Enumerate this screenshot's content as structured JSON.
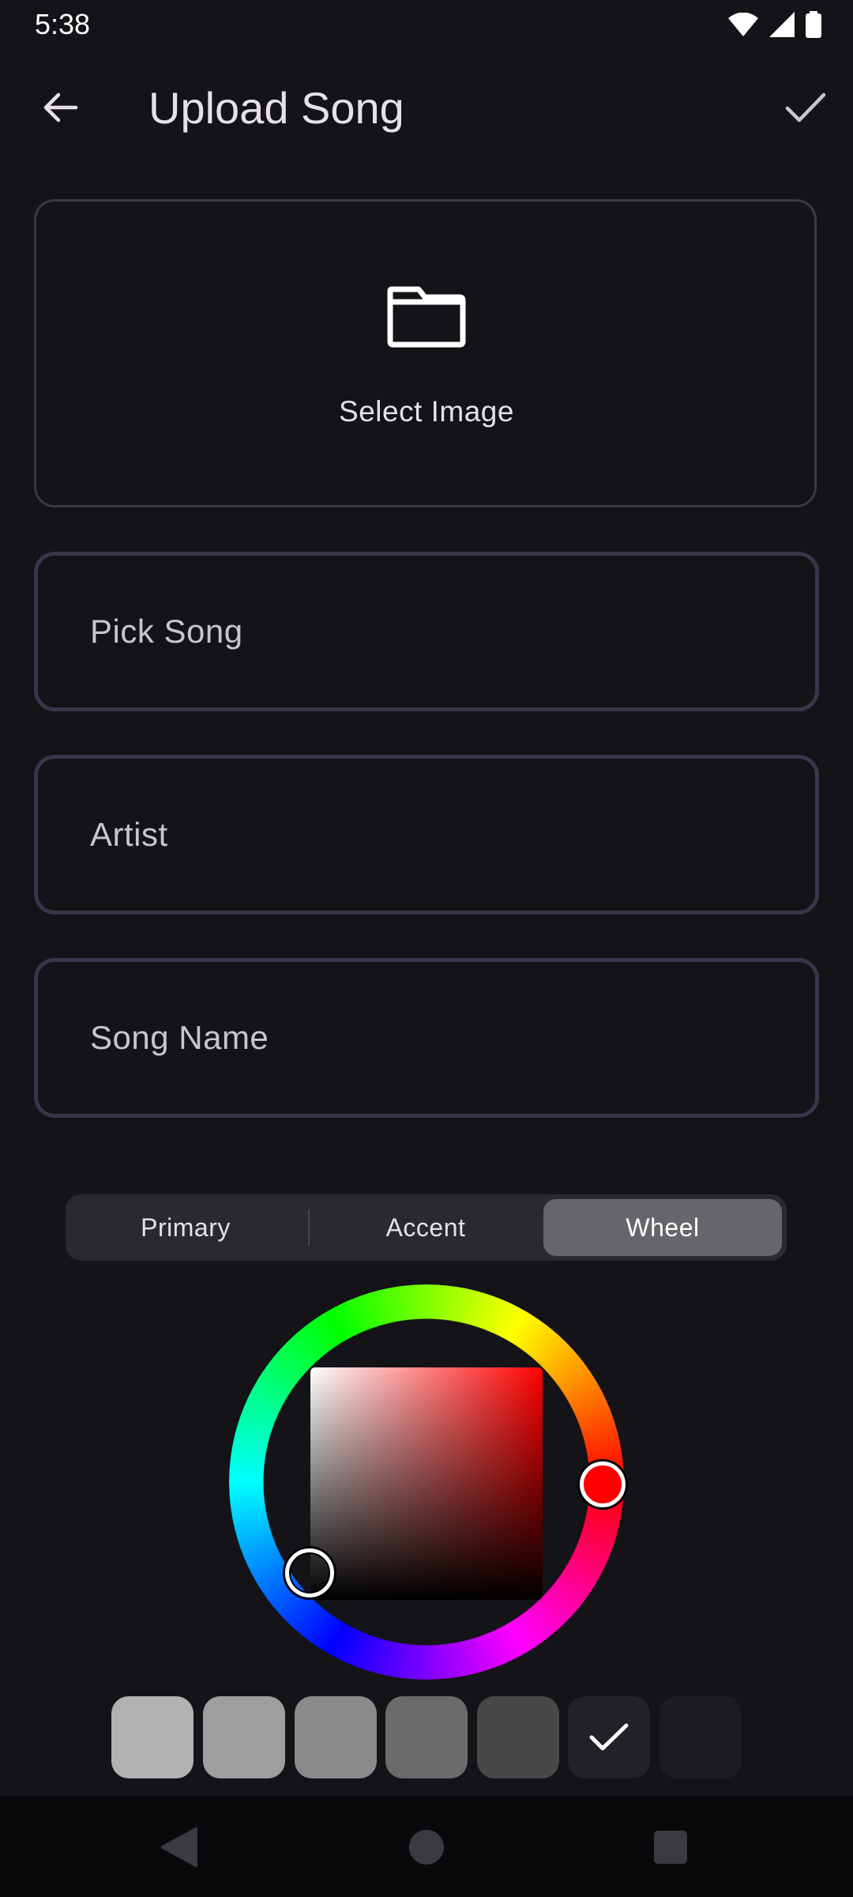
{
  "status_bar": {
    "time": "5:38",
    "icons": [
      "wifi-icon",
      "signal-icon",
      "battery-icon"
    ]
  },
  "app_bar": {
    "title": "Upload Song",
    "back_icon": "arrow-back-icon",
    "confirm_icon": "check-icon"
  },
  "image_picker": {
    "label": "Select Image",
    "icon": "folder-icon"
  },
  "fields": {
    "pick_song": {
      "label": "Pick Song"
    },
    "artist": {
      "label": "Artist"
    },
    "song_name": {
      "label": "Song Name"
    }
  },
  "color_picker": {
    "tabs": [
      {
        "label": "Primary",
        "selected": false
      },
      {
        "label": "Accent",
        "selected": false
      },
      {
        "label": "Wheel",
        "selected": true
      }
    ],
    "selected_hue_color": "#ff0000",
    "selected_color": "#ffffff",
    "swatches": [
      "#b1b1b1",
      "#9e9e9e",
      "#8a8a8a",
      "#6b6b6b",
      "#484848",
      "#222226",
      "#1c1c20"
    ],
    "selected_swatch_index": 5
  },
  "nav_bar": {
    "icons": [
      "back-triangle-icon",
      "home-circle-icon",
      "recents-square-icon"
    ]
  }
}
